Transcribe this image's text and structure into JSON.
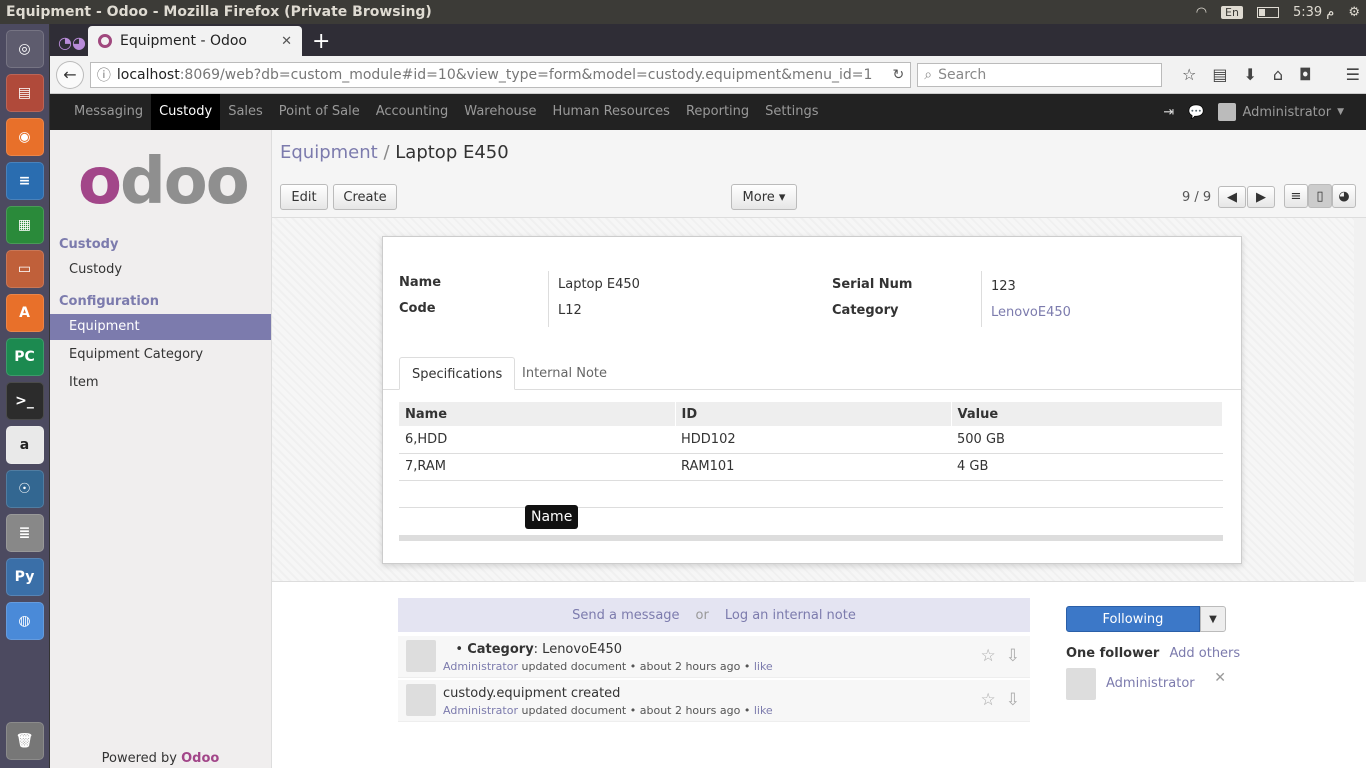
{
  "os_bar": {
    "title": "Equipment - Odoo - Mozilla Firefox (Private Browsing)",
    "lang": "En",
    "clock": "م 5:39"
  },
  "browser": {
    "tab_title": "Equipment - Odoo",
    "url_host": "localhost",
    "url_rest": ":8069/web?db=custom_module#id=10&view_type=form&model=custody.equipment&menu_id=1",
    "search_placeholder": "Search"
  },
  "topnav": {
    "items": [
      "Messaging",
      "Custody",
      "Sales",
      "Point of Sale",
      "Accounting",
      "Warehouse",
      "Human Resources",
      "Reporting",
      "Settings"
    ],
    "active": "Custody",
    "user": "Administrator"
  },
  "sidebar": {
    "logo": "odoo",
    "section1": "Custody",
    "section1_items": [
      "Custody"
    ],
    "section2": "Configuration",
    "section2_items": [
      "Equipment",
      "Equipment Category",
      "Item"
    ],
    "active": "Equipment",
    "powered_prefix": "Powered by",
    "powered_brand": "Odoo"
  },
  "control_panel": {
    "breadcrumb_parent": "Equipment",
    "breadcrumb_sep": "/",
    "breadcrumb_current": "Laptop E450",
    "edit_label": "Edit",
    "create_label": "Create",
    "more_label": "More ▾",
    "pager": "9 / 9"
  },
  "form": {
    "name_label": "Name",
    "name_value": "Laptop E450",
    "code_label": "Code",
    "code_value": "L12",
    "serial_label": "Serial Num",
    "serial_value": "123",
    "category_label": "Category",
    "category_value": "LenovoE450",
    "tabs": [
      "Specifications",
      "Internal Note"
    ],
    "table": {
      "headers": [
        "Name",
        "ID",
        "Value"
      ],
      "rows": [
        [
          "6,HDD",
          "HDD102",
          "500 GB"
        ],
        [
          "7,RAM",
          "RAM101",
          "4 GB"
        ]
      ]
    },
    "tooltip": "Name"
  },
  "chatter": {
    "send_message": "Send a message",
    "or": "or",
    "log_note": "Log an internal note",
    "messages": [
      {
        "title_bold": "Category",
        "title_rest": ": LenovoE450",
        "author": "Administrator",
        "action": "updated document",
        "time": "about 2 hours ago",
        "like": "like"
      },
      {
        "title_bold": "",
        "title_rest": "custody.equipment created",
        "author": "Administrator",
        "action": "updated document",
        "time": "about 2 hours ago",
        "like": "like"
      }
    ],
    "following_label": "Following",
    "followers_count": "One follower",
    "add_others": "Add others",
    "follower_name": "Administrator"
  },
  "colors": {
    "brand": "#a24689",
    "accent": "#7c7bad",
    "topbar": "#222222",
    "follow_btn": "#3c78c8"
  }
}
